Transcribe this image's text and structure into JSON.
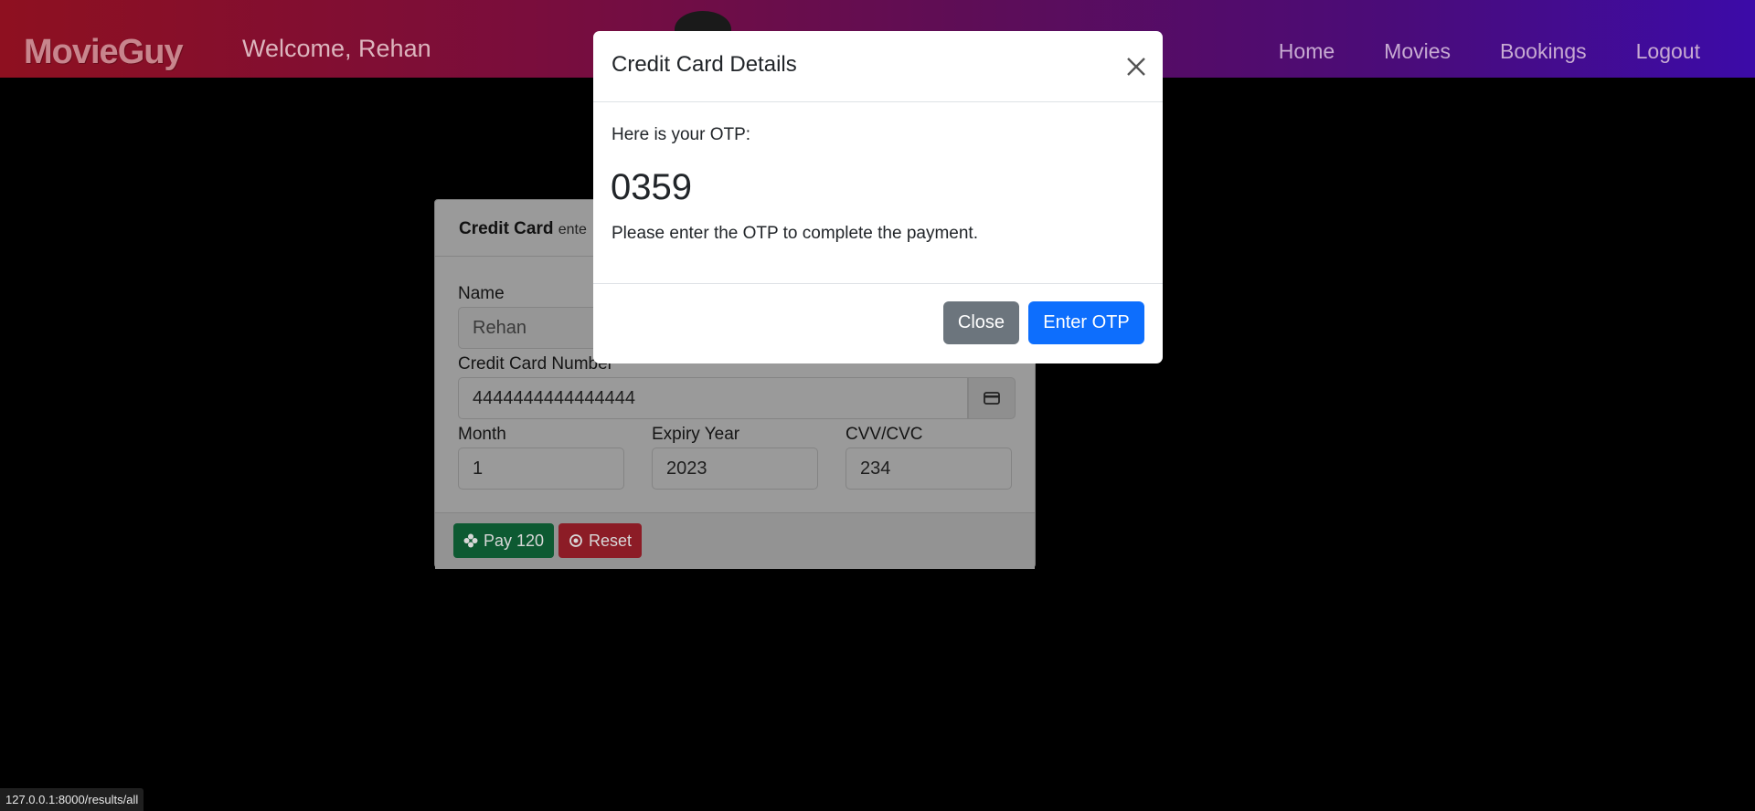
{
  "navbar": {
    "brand": "MovieGuy",
    "welcome": "Welcome, Rehan",
    "links": [
      "Home",
      "Movies",
      "Bookings",
      "Logout"
    ]
  },
  "payment_card": {
    "header_title": "Credit Card",
    "header_sub": "ente",
    "name_label": "Name",
    "name_value": "Rehan",
    "card_number_label": "Credit Card Number",
    "card_number_value": "4444444444444444",
    "card_icon": "credit-card-icon",
    "month_label": "Month",
    "month_value": "1",
    "year_label": "Expiry Year",
    "year_value": "2023",
    "cvv_label": "CVV/CVC",
    "cvv_value": "234",
    "pay_label": "Pay 120",
    "reset_label": "Reset"
  },
  "modal": {
    "title": "Credit Card Details",
    "intro": "Here is your OTP:",
    "otp": "0359",
    "note": "Please enter the OTP to complete the payment.",
    "close_label": "Close",
    "enter_otp_label": "Enter OTP"
  },
  "statusbar": {
    "url": "127.0.0.1:8000/results/all"
  },
  "colors": {
    "primary": "#0d6efd",
    "secondary": "#6c757d",
    "success": "#198754",
    "danger": "#dc3545"
  }
}
